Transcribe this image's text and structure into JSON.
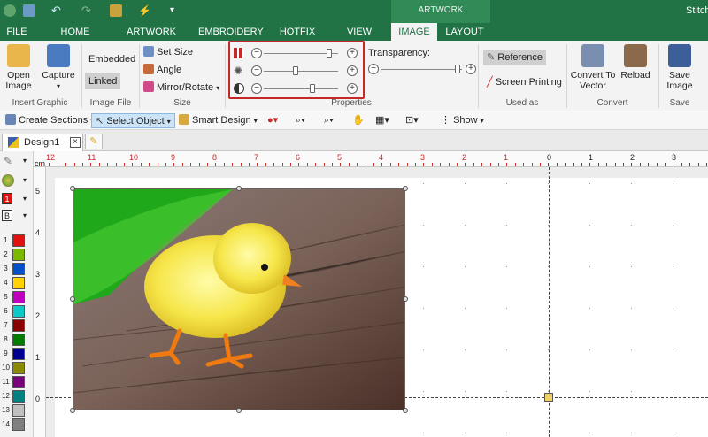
{
  "window": {
    "title": "Stitch"
  },
  "ribbon_tabs": {
    "file": "FILE",
    "home": "HOME",
    "artwork": "ARTWORK",
    "embroidery": "EMBROIDERY",
    "hotfix": "HOTFIX",
    "view": "VIEW",
    "image": "IMAGE",
    "layout": "LAYOUT",
    "context_group": "ARTWORK"
  },
  "insert_graphic": {
    "open_image": "Open Image",
    "capture": "Capture",
    "label": "Insert Graphic"
  },
  "image_file": {
    "embedded": "Embedded",
    "linked": "Linked",
    "label": "Image File"
  },
  "size": {
    "set_size": "Set Size",
    "angle": "Angle",
    "mirror_rotate": "Mirror/Rotate",
    "label": "Size"
  },
  "properties": {
    "label": "Properties",
    "brightness": 0.88,
    "saturation": 0.43,
    "contrast": 0.66,
    "transparency_label": "Transparency:",
    "transparency": 0.95
  },
  "used_as": {
    "reference": "Reference",
    "screen_printing": "Screen Printing",
    "label": "Used as"
  },
  "convert": {
    "convert_to_vector": "Convert To Vector",
    "reload": "Reload",
    "label": "Convert"
  },
  "save": {
    "save_image": "Save Image",
    "label": "Save"
  },
  "toolbar": {
    "create_sections": "Create Sections",
    "select_object": "Select Object",
    "smart_design": "Smart Design",
    "show": "Show"
  },
  "doc_tab": {
    "name": "Design1"
  },
  "palette": [
    {
      "n": "1",
      "color": "#e01010"
    },
    {
      "n": "2",
      "color": "#7ab800"
    },
    {
      "n": "3",
      "color": "#0050c8"
    },
    {
      "n": "4",
      "color": "#ffd200"
    },
    {
      "n": "5",
      "color": "#c000c0"
    },
    {
      "n": "6",
      "color": "#10c8c8"
    },
    {
      "n": "7",
      "color": "#8a0000"
    },
    {
      "n": "8",
      "color": "#007a00"
    },
    {
      "n": "9",
      "color": "#000090"
    },
    {
      "n": "10",
      "color": "#8a8a00"
    },
    {
      "n": "11",
      "color": "#7a007a"
    },
    {
      "n": "12",
      "color": "#008080"
    },
    {
      "n": "13",
      "color": "#c0c0c0"
    },
    {
      "n": "14",
      "color": "#808080"
    }
  ],
  "left_tools": {
    "color1": "1",
    "colorB": "B"
  },
  "ruler": {
    "unit": "cm",
    "top_red": [
      "12",
      "11",
      "10",
      "9",
      "8",
      "7",
      "6",
      "5",
      "4",
      "3",
      "2",
      "1"
    ],
    "top_black": [
      "0",
      "1",
      "2",
      "3"
    ],
    "left": [
      "5",
      "4",
      "3",
      "2",
      "1",
      "0"
    ]
  }
}
